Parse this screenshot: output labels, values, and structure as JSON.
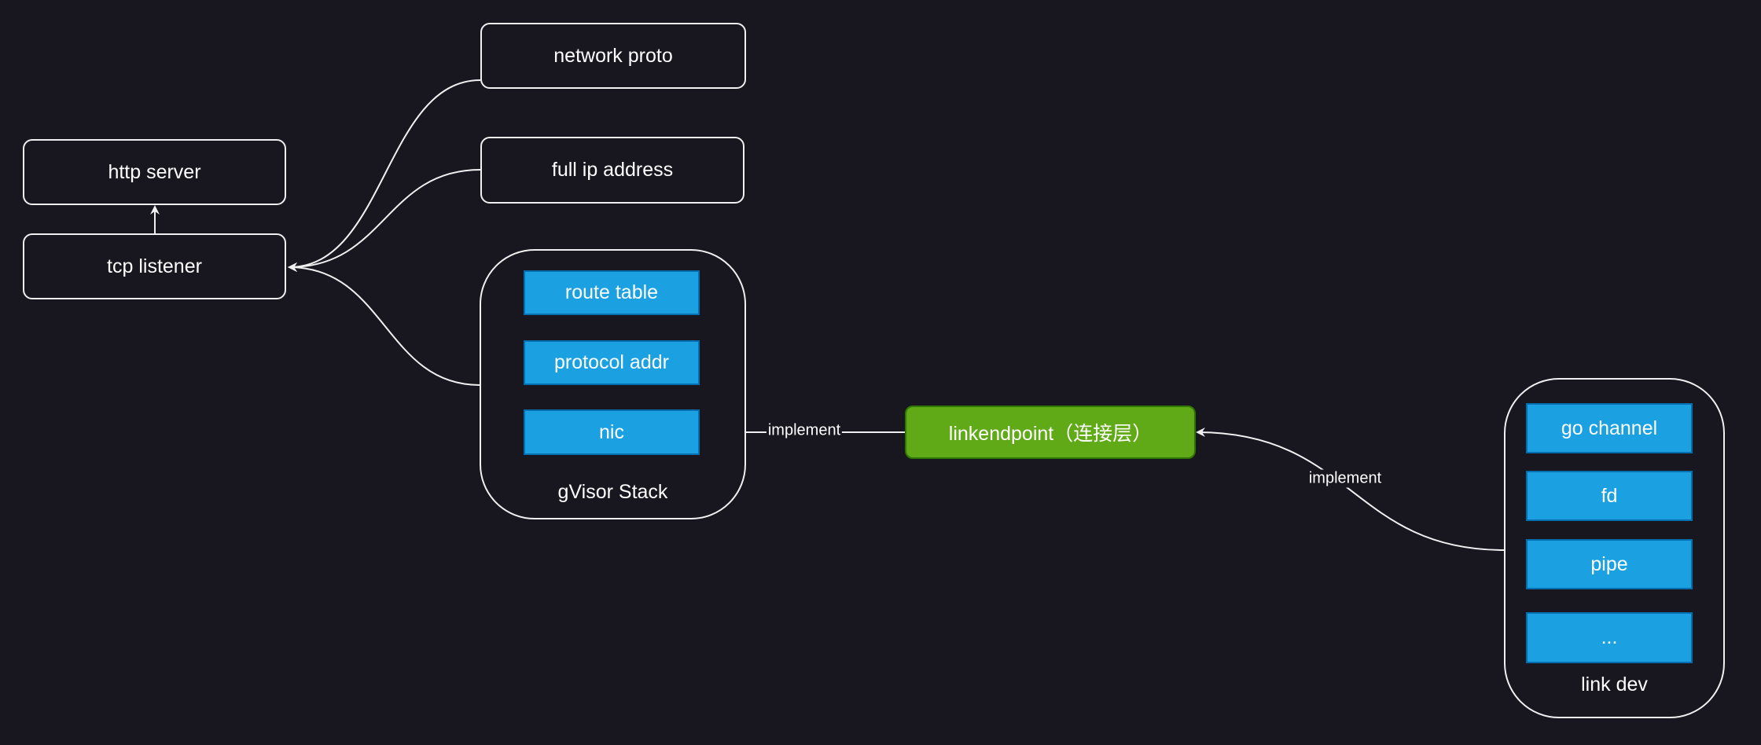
{
  "colors": {
    "background": "#18161f",
    "component": "#1ba1e2",
    "linkendpoint": "#60a917",
    "border": "#f0f0f0"
  },
  "nodes": {
    "network_proto": "network proto",
    "http_server": "http server",
    "full_ip_address": "full ip address",
    "tcp_listener": "tcp listener",
    "gvisor_stack": {
      "label": "gVisor Stack",
      "items": [
        "route table",
        "protocol addr",
        "nic"
      ]
    },
    "linkendpoint": "linkendpoint（连接层）",
    "link_dev": {
      "label": "link dev",
      "items": [
        "go channel",
        "fd",
        "pipe",
        "..."
      ]
    }
  },
  "edges": {
    "nic_implement": "implement",
    "linkdev_implement": "implement"
  }
}
